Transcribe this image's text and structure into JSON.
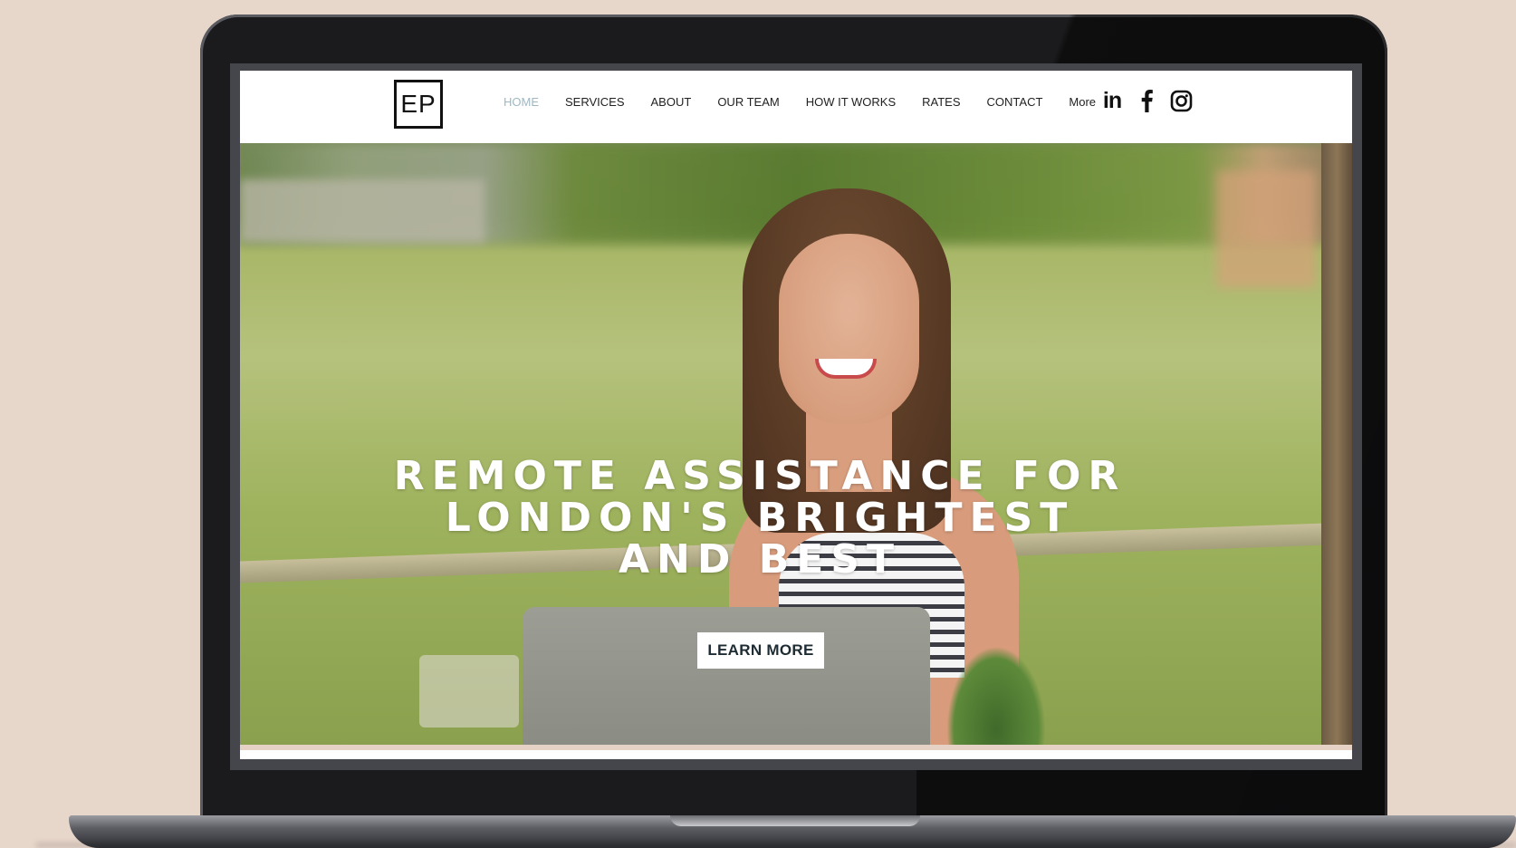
{
  "site": {
    "logo_text": "EP",
    "nav": [
      {
        "label": "HOME",
        "active": true
      },
      {
        "label": "SERVICES",
        "active": false
      },
      {
        "label": "ABOUT",
        "active": false
      },
      {
        "label": "OUR TEAM",
        "active": false
      },
      {
        "label": "HOW IT WORKS",
        "active": false
      },
      {
        "label": "RATES",
        "active": false
      },
      {
        "label": "CONTACT",
        "active": false
      },
      {
        "label": "More",
        "active": false
      }
    ],
    "social": [
      {
        "name": "linkedin-icon",
        "glyph": "in"
      },
      {
        "name": "facebook-icon",
        "glyph": "f"
      },
      {
        "name": "instagram-icon",
        "glyph": ""
      }
    ]
  },
  "hero": {
    "headline_lines": [
      "REMOTE ASSISTANCE FOR",
      "LONDON'S BRIGHTEST",
      "AND BEST"
    ],
    "cta_label": "LEARN MORE"
  },
  "colors": {
    "background": "#e7d6ca",
    "nav_active": "#9fb8c3",
    "cta_text": "#1d2b33"
  }
}
